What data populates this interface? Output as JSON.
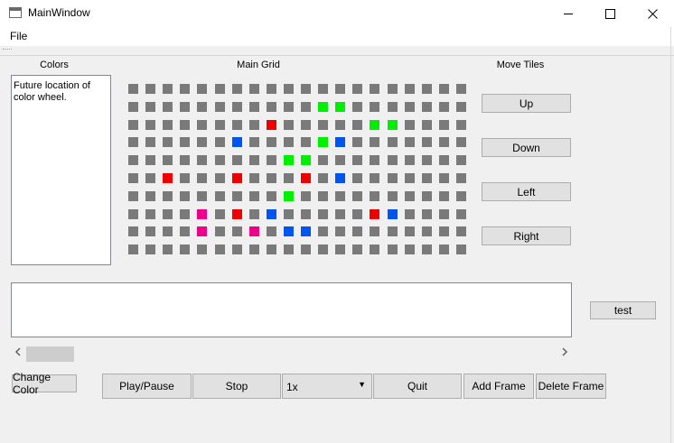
{
  "window": {
    "title": "MainWindow"
  },
  "menu": {
    "file": "File"
  },
  "labels": {
    "colors": "Colors",
    "main_grid": "Main Grid",
    "move_tiles": "Move Tiles"
  },
  "colors_panel": {
    "text": "Future location of color wheel."
  },
  "move_buttons": {
    "up": "Up",
    "down": "Down",
    "left": "Left",
    "right": "Right"
  },
  "test_button": "test",
  "bottom": {
    "change_color": "Change Color",
    "play_pause": "Play/Pause",
    "stop": "Stop",
    "speed": "1x",
    "quit": "Quit",
    "add_frame": "Add Frame",
    "delete_frame": "Delete Frame"
  },
  "grid": {
    "rows": 10,
    "cols": 20,
    "default_color": "#7a7a7a",
    "colored_tiles": [
      {
        "row": 1,
        "col": 11,
        "color": "#00ee00"
      },
      {
        "row": 1,
        "col": 12,
        "color": "#00ee00"
      },
      {
        "row": 2,
        "col": 8,
        "color": "#ee0000"
      },
      {
        "row": 2,
        "col": 14,
        "color": "#00ee00"
      },
      {
        "row": 2,
        "col": 15,
        "color": "#00ee00"
      },
      {
        "row": 3,
        "col": 6,
        "color": "#0055ee"
      },
      {
        "row": 3,
        "col": 11,
        "color": "#00ee00"
      },
      {
        "row": 3,
        "col": 12,
        "color": "#0055ee"
      },
      {
        "row": 4,
        "col": 9,
        "color": "#00ee00"
      },
      {
        "row": 4,
        "col": 10,
        "color": "#00ee00"
      },
      {
        "row": 5,
        "col": 2,
        "color": "#ee0000"
      },
      {
        "row": 5,
        "col": 6,
        "color": "#ee0000"
      },
      {
        "row": 5,
        "col": 10,
        "color": "#ee0000"
      },
      {
        "row": 5,
        "col": 12,
        "color": "#0055ee"
      },
      {
        "row": 6,
        "col": 9,
        "color": "#00ee00"
      },
      {
        "row": 7,
        "col": 4,
        "color": "#ee0088"
      },
      {
        "row": 7,
        "col": 6,
        "color": "#ee0000"
      },
      {
        "row": 7,
        "col": 8,
        "color": "#0055ee"
      },
      {
        "row": 7,
        "col": 14,
        "color": "#ee0000"
      },
      {
        "row": 7,
        "col": 15,
        "color": "#0055ee"
      },
      {
        "row": 8,
        "col": 4,
        "color": "#ee0088"
      },
      {
        "row": 8,
        "col": 7,
        "color": "#ee0088"
      },
      {
        "row": 8,
        "col": 9,
        "color": "#0055ee"
      },
      {
        "row": 8,
        "col": 10,
        "color": "#0055ee"
      }
    ]
  },
  "icons": {
    "app": "app-window-icon",
    "minimize": "minimize-icon",
    "maximize": "maximize-icon",
    "close": "close-icon",
    "scroll_left": "chevron-left-icon",
    "scroll_right": "chevron-right-icon",
    "dropdown": "dropdown-arrow-icon"
  }
}
